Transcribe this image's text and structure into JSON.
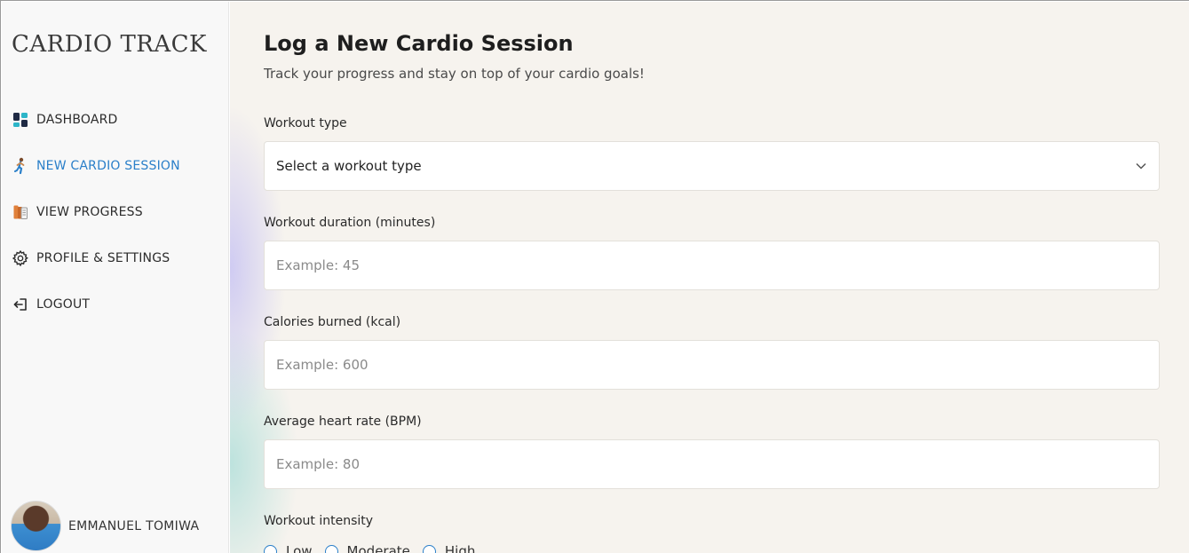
{
  "sidebar": {
    "brand": "CARDIO TRACK",
    "items": [
      {
        "label": "DASHBOARD",
        "icon": "dashboard-icon"
      },
      {
        "label": "NEW CARDIO SESSION",
        "icon": "runner-icon"
      },
      {
        "label": "VIEW PROGRESS",
        "icon": "books-icon"
      },
      {
        "label": "PROFILE & SETTINGS",
        "icon": "gear-icon"
      },
      {
        "label": "LOGOUT",
        "icon": "logout-icon"
      }
    ],
    "active_color": "#2a7fc9",
    "user": {
      "name": "EMMANUEL TOMIWA"
    }
  },
  "main": {
    "title": "Log a New Cardio Session",
    "subtitle": "Track your progress and stay on top of your cardio goals!",
    "workout_type": {
      "label": "Workout type",
      "selected": "Select a workout type"
    },
    "duration": {
      "label": "Workout duration (minutes)",
      "placeholder": "Example: 45"
    },
    "calories": {
      "label": "Calories burned (kcal)",
      "placeholder": "Example: 600"
    },
    "heart_rate": {
      "label": "Average heart rate (BPM)",
      "placeholder": "Example: 80"
    },
    "intensity": {
      "label": "Workout intensity",
      "options": [
        "Low",
        "Moderate",
        "High"
      ]
    }
  }
}
